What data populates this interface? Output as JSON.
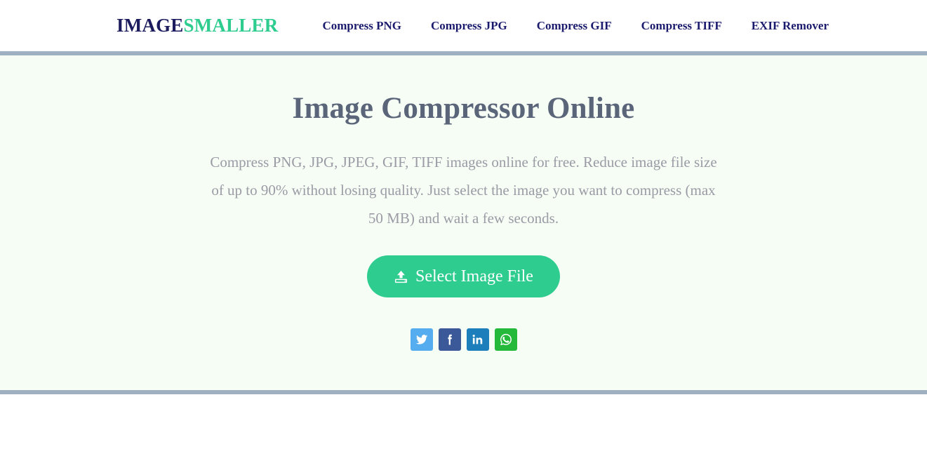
{
  "header": {
    "logo": {
      "part1": "IMAGE",
      "part2": "SMALLER",
      "part1_color": "#1b1b5e",
      "part2_color": "#2ecc8f"
    },
    "nav": [
      {
        "label": "Compress PNG",
        "name": "nav-compress-png"
      },
      {
        "label": "Compress JPG",
        "name": "nav-compress-jpg"
      },
      {
        "label": "Compress GIF",
        "name": "nav-compress-gif"
      },
      {
        "label": "Compress TIFF",
        "name": "nav-compress-tiff"
      },
      {
        "label": "EXIF Remover",
        "name": "nav-exif-remover"
      }
    ],
    "nav_color": "#1b1b6e",
    "background": "#ffffff"
  },
  "divider": {
    "color": "#9fb1c1"
  },
  "hero": {
    "background": "#f6fdf5",
    "title": "Image Compressor Online",
    "title_color": "#5a6579",
    "description": "Compress PNG, JPG, JPEG, GIF, TIFF images online for free. Reduce image file size of up to 90% without losing quality. Just select the image you want to compress (max 50 MB) and wait a few seconds.",
    "description_color": "#9b9ba5",
    "button": {
      "label": "Select Image File",
      "icon": "upload-icon",
      "background": "#2ecc8f",
      "text_color": "#ffffff"
    },
    "social": [
      {
        "label": "Twitter",
        "name": "social-twitter",
        "color": "#55acee"
      },
      {
        "label": "Facebook",
        "name": "social-facebook",
        "color": "#3b5998"
      },
      {
        "label": "LinkedIn",
        "name": "social-linkedin",
        "color": "#1c7ebb"
      },
      {
        "label": "WhatsApp",
        "name": "social-whatsapp",
        "color": "#25b93c"
      }
    ]
  }
}
